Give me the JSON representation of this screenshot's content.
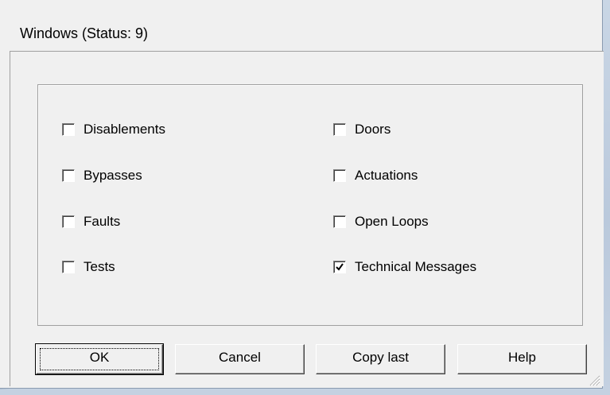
{
  "window": {
    "title": "Windows (Status: 9)"
  },
  "checkboxes": {
    "left": [
      {
        "label": "Disablements",
        "checked": false
      },
      {
        "label": "Bypasses",
        "checked": false
      },
      {
        "label": "Faults",
        "checked": false
      },
      {
        "label": "Tests",
        "checked": false
      }
    ],
    "right": [
      {
        "label": "Doors",
        "checked": false
      },
      {
        "label": "Actuations",
        "checked": false
      },
      {
        "label": "Open Loops",
        "checked": false
      },
      {
        "label": "Technical Messages",
        "checked": true
      }
    ]
  },
  "buttons": {
    "ok": "OK",
    "cancel": "Cancel",
    "copy_last": "Copy last",
    "help": "Help"
  },
  "colors": {
    "dialog_bg": "#f0f0f0",
    "frame_blue": "#bac9dc"
  }
}
